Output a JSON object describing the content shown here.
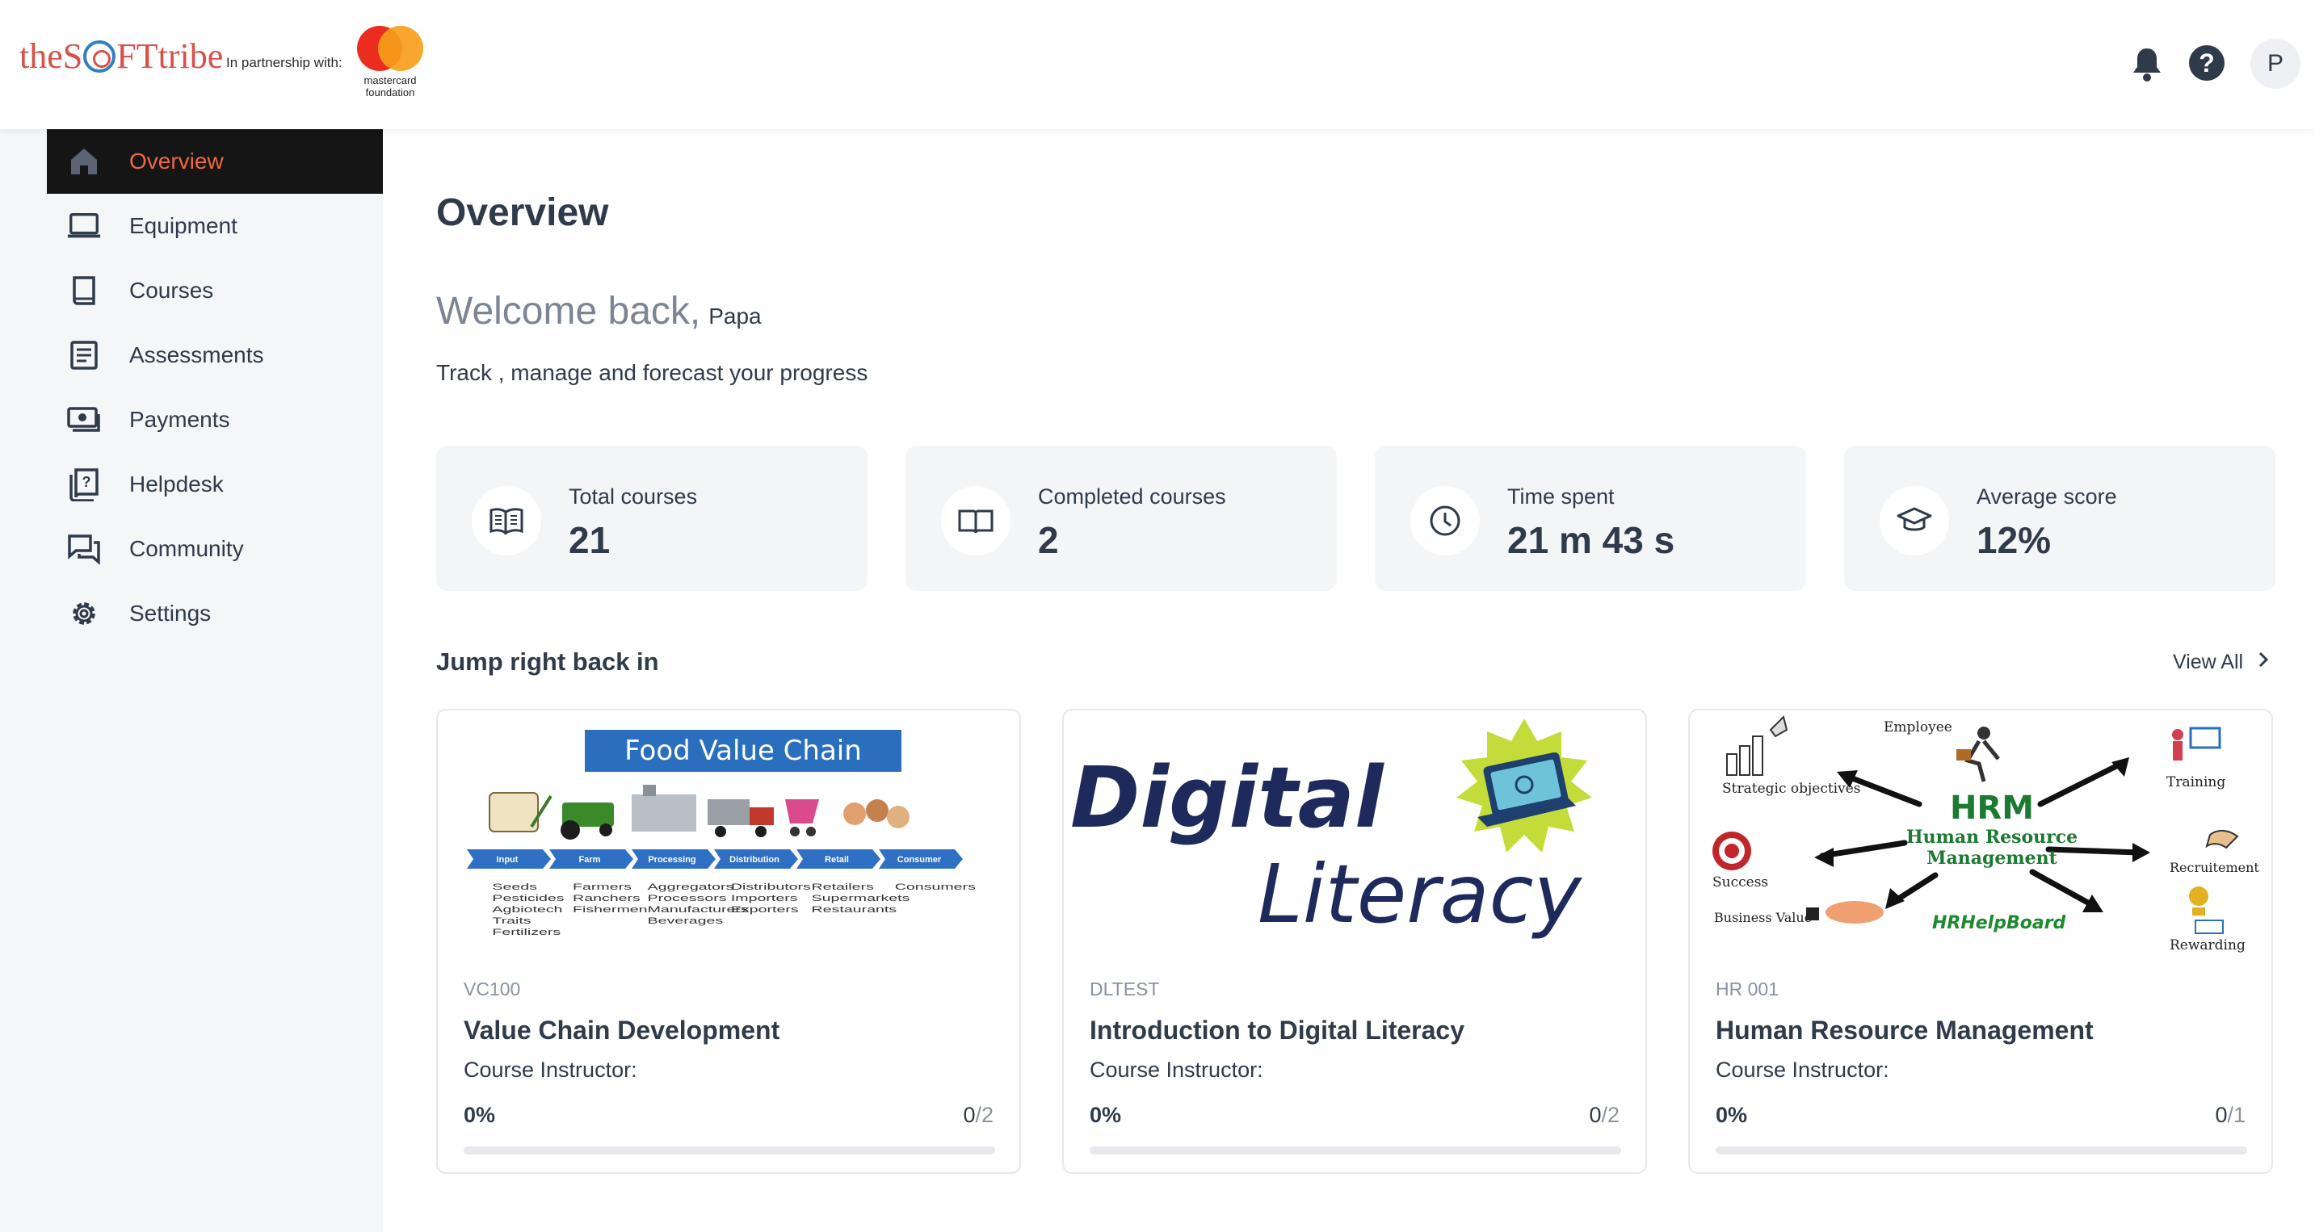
{
  "header": {
    "brand": {
      "pre": "the",
      "s": "S",
      "post": "FT",
      "tribe": "tribe"
    },
    "partnership_label": "In partnership with:",
    "partner_name": "mastercard foundation",
    "avatar_initial": "P"
  },
  "sidebar": {
    "items": [
      {
        "label": "Overview",
        "icon": "home-icon",
        "active": true
      },
      {
        "label": "Equipment",
        "icon": "laptop-icon"
      },
      {
        "label": "Courses",
        "icon": "book-icon"
      },
      {
        "label": "Assessments",
        "icon": "document-list-icon"
      },
      {
        "label": "Payments",
        "icon": "cash-icon"
      },
      {
        "label": "Helpdesk",
        "icon": "question-book-icon"
      },
      {
        "label": "Community",
        "icon": "chat-icon"
      },
      {
        "label": "Settings",
        "icon": "gear-icon"
      }
    ]
  },
  "main": {
    "title": "Overview",
    "welcome": "Welcome back,",
    "user_name": "Papa",
    "tagline": "Track , manage and forecast your progress",
    "stats": [
      {
        "label": "Total courses",
        "value": "21",
        "icon": "open-book-icon"
      },
      {
        "label": "Completed courses",
        "value": "2",
        "icon": "open-book-outline-icon"
      },
      {
        "label": "Time spent",
        "value": "21 m 43 s",
        "icon": "clock-icon"
      },
      {
        "label": "Average score",
        "value": "12%",
        "icon": "graduation-cap-icon"
      }
    ],
    "section_title": "Jump right back in",
    "view_all": "View All",
    "courses": [
      {
        "code": "VC100",
        "title": "Value Chain Development",
        "instructor_label": "Course Instructor:",
        "progress_label": "0%",
        "progress": 0,
        "done": "0",
        "total": "/2",
        "thumb": {
          "heading": "Food Value Chain",
          "stages": [
            "Input",
            "Farm",
            "Processing",
            "Distribution",
            "Retail",
            "Consumer"
          ],
          "details": [
            "Seeds\nPesticides\nAgbiotech\nTraits\nFertilizers",
            "Farmers\nRanchers\nFishermen",
            "Aggregators\nProcessors\nManufacturers\nBeverages",
            "Distributors\nImporters\nExporters",
            "Retailers\nSupermarkets\nRestaurants",
            "Consumers"
          ]
        }
      },
      {
        "code": "DLTEST",
        "title": "Introduction to Digital Literacy",
        "instructor_label": "Course Instructor:",
        "progress_label": "0%",
        "progress": 0,
        "done": "0",
        "total": "/2",
        "thumb": {
          "line1": "Digital",
          "line2": "Literacy"
        }
      },
      {
        "code": "HR 001",
        "title": "Human Resource Management",
        "instructor_label": "Course Instructor:",
        "progress_label": "0%",
        "progress": 0,
        "done": "0",
        "total": "/1",
        "thumb": {
          "center": "HRM",
          "center_sub1": "Human Resource",
          "center_sub2": "Management",
          "labels": [
            "Employee",
            "Strategic objectives",
            "Training",
            "Success",
            "Recruitement",
            "Business Value",
            "HRHelpBoard",
            "Rewarding"
          ]
        }
      }
    ]
  },
  "colors": {
    "accent": "#f0683c",
    "active_bg": "#151515",
    "text": "#2f3a4a",
    "muted": "#8a92a0",
    "stat_bg": "#f4f5f7"
  }
}
